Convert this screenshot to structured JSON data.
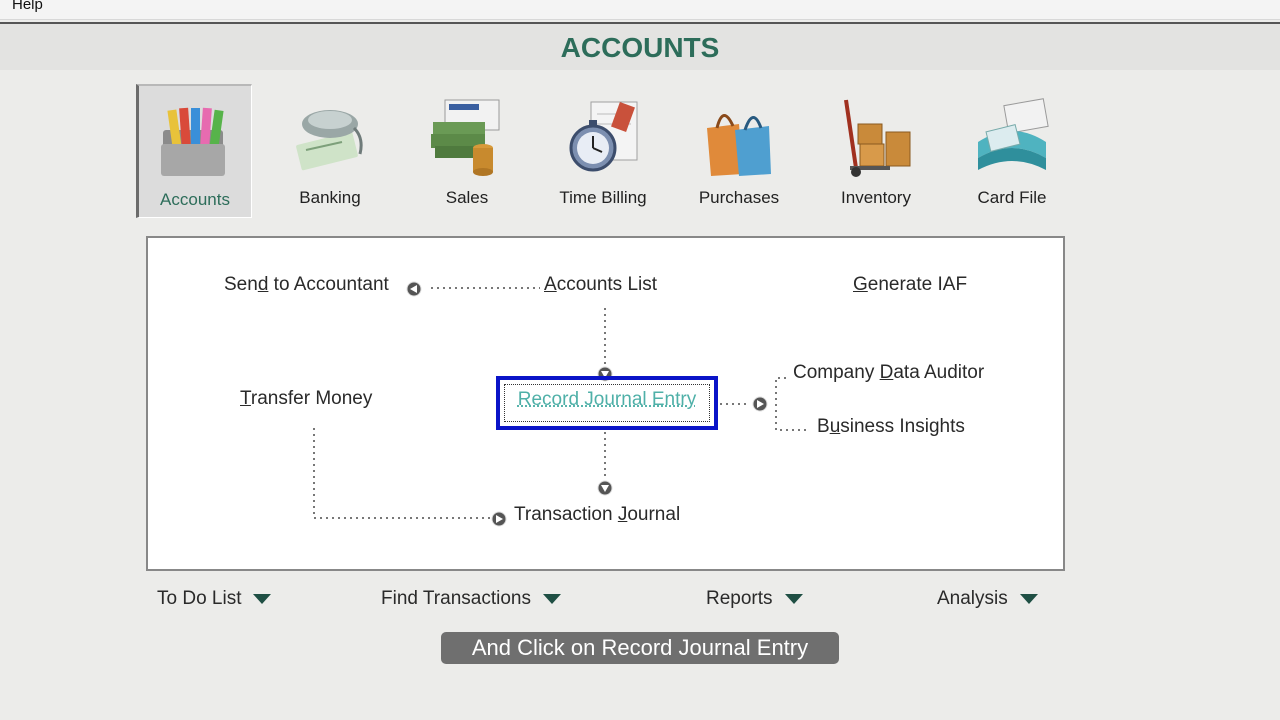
{
  "menu": {
    "help_label": "Help"
  },
  "header": {
    "title": "ACCOUNTS"
  },
  "modules": [
    {
      "label": "Accounts",
      "icon": "folders-icon"
    },
    {
      "label": "Banking",
      "icon": "mouse-cheque-icon"
    },
    {
      "label": "Sales",
      "icon": "invoice-coins-icon"
    },
    {
      "label": "Time Billing",
      "icon": "stopwatch-icon"
    },
    {
      "label": "Purchases",
      "icon": "shopping-bags-icon"
    },
    {
      "label": "Inventory",
      "icon": "hand-truck-boxes-icon"
    },
    {
      "label": "Card File",
      "icon": "card-file-icon"
    }
  ],
  "flow": {
    "send_to_accountant": {
      "pre": "Sen",
      "u": "d",
      "post": " to Accountant"
    },
    "accounts_list": {
      "pre": "",
      "u": "A",
      "post": "ccounts List"
    },
    "generate_iaf": {
      "pre": "",
      "u": "G",
      "post": "enerate IAF"
    },
    "transfer_money": {
      "pre": "",
      "u": "T",
      "post": "ransfer Money"
    },
    "record_journal_entry": "Record Journal Entry",
    "company_data_auditor": {
      "pre": "Company ",
      "u": "D",
      "post": "ata Auditor"
    },
    "business_insights": {
      "pre": "B",
      "u": "u",
      "post": "siness Insights"
    },
    "transaction_journal": {
      "pre": "Transaction ",
      "u": "J",
      "post": "ournal"
    }
  },
  "dropdowns": {
    "todo": "To Do List",
    "find": "Find Transactions",
    "reports": "Reports",
    "analysis": "Analysis"
  },
  "caption": "And Click on Record Journal Entry",
  "colors": {
    "title": "#2d6d5a",
    "selection_border": "#0a14c8",
    "selected_text": "#4fb0a8",
    "caret": "#1f4f44"
  }
}
